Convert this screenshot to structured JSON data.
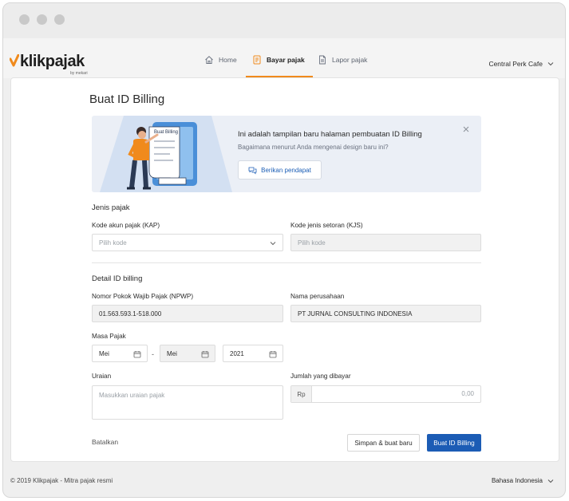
{
  "brand": {
    "name": "klikpajak",
    "sub": "by mekari",
    "accent": "#f08a1c",
    "primary": "#1c5cb5"
  },
  "nav": {
    "tabs": [
      {
        "label": "Home",
        "icon": "home-icon"
      },
      {
        "label": "Bayar pajak",
        "icon": "receipt-icon",
        "active": true
      },
      {
        "label": "Lapor pajak",
        "icon": "document-icon"
      }
    ],
    "company": "Central Perk Cafe"
  },
  "page": {
    "title": "Buat ID Billing"
  },
  "banner": {
    "title": "Ini adalah tampilan baru halaman pembuatan ID Billing",
    "subtitle": "Bagaimana menurut Anda mengenai design baru ini?",
    "button": "Berikan pendapat",
    "illustration_text": "Buat Billing"
  },
  "jenis_pajak": {
    "heading": "Jenis pajak",
    "kap_label": "Kode akun pajak (KAP)",
    "kap_placeholder": "Pilih kode",
    "kjs_label": "Kode jenis setoran (KJS)",
    "kjs_placeholder": "Pilih kode"
  },
  "detail": {
    "heading": "Detail ID billing",
    "npwp_label": "Nomor Pokok Wajib Pajak (NPWP)",
    "npwp_value": "01.563.593.1-518.000",
    "company_label": "Nama perusahaan",
    "company_value": "PT JURNAL CONSULTING INDONESIA",
    "masa_label": "Masa Pajak",
    "masa_from": "Mei",
    "masa_separator": "-",
    "masa_to": "Mei",
    "year": "2021",
    "uraian_label": "Uraian",
    "uraian_placeholder": "Masukkan uraian pajak",
    "jumlah_label": "Jumlah yang dibayar",
    "currency": "Rp",
    "amount_placeholder": "0,00"
  },
  "actions": {
    "cancel": "Batalkan",
    "save_new": "Simpan & buat baru",
    "submit": "Buat ID Billing"
  },
  "footer": {
    "copyright": "© 2019 Klikpajak - Mitra pajak resmi",
    "language": "Bahasa Indonesia"
  }
}
